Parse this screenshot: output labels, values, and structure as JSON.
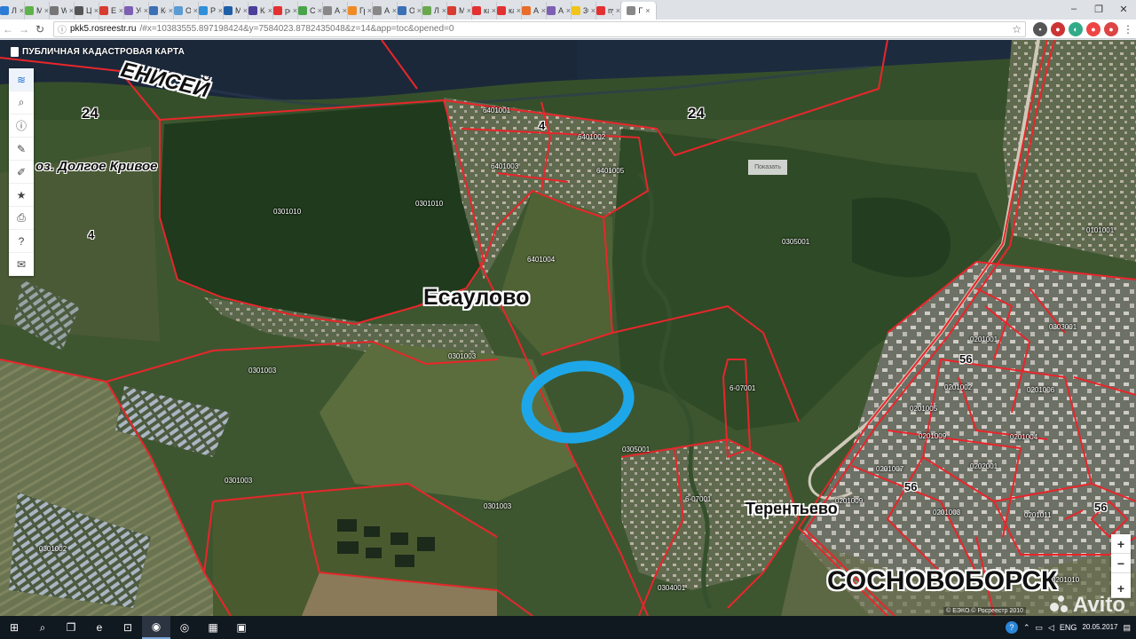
{
  "browser": {
    "tabs": [
      {
        "label": "Лич",
        "color": "#2d7bd6"
      },
      {
        "label": "Мо",
        "color": "#5fb24a"
      },
      {
        "label": "Wiu",
        "color": "#777777"
      },
      {
        "label": "Цен",
        "color": "#555555"
      },
      {
        "label": "Ekin",
        "color": "#d83b30"
      },
      {
        "label": "Услу",
        "color": "#7d5fb3"
      },
      {
        "label": "Конт",
        "color": "#3b6fb6"
      },
      {
        "label": "ООС",
        "color": "#5a9bd5"
      },
      {
        "label": "Реда",
        "color": "#2f8fd8"
      },
      {
        "label": "Мои",
        "color": "#1f5fa8"
      },
      {
        "label": "Каби",
        "color": "#4a3f9a"
      },
      {
        "label": "рекл",
        "color": "#e33131"
      },
      {
        "label": "Спец",
        "color": "#4aa34a"
      },
      {
        "label": "Арен",
        "color": "#888888"
      },
      {
        "label": "Груп",
        "color": "#f08a24"
      },
      {
        "label": "Арен",
        "color": "#888888"
      },
      {
        "label": "Объ",
        "color": "#3b6fb6"
      },
      {
        "label": "Лизн",
        "color": "#6aa84f"
      },
      {
        "label": "Мой",
        "color": "#d83b30"
      },
      {
        "label": "как",
        "color": "#e33131"
      },
      {
        "label": "кам",
        "color": "#e33131"
      },
      {
        "label": "Арен",
        "color": "#e86c2a"
      },
      {
        "label": "Арен",
        "color": "#7d5fb3"
      },
      {
        "label": "365",
        "color": "#f0c419"
      },
      {
        "label": "пуб",
        "color": "#e33131"
      },
      {
        "label": "Г",
        "color": "#888888",
        "active": true
      }
    ],
    "window_controls": [
      "–",
      "❐",
      "✕"
    ],
    "nav": {
      "back": "←",
      "forward": "→",
      "reload": "↻"
    },
    "url_host": "pkk5.rosreestr.ru",
    "url_rest": "/#x=10383555.897198424&y=7584023.8782435048&z=14&app=toc&opened=0",
    "star": "☆"
  },
  "map": {
    "title": "ПУБЛИЧНАЯ КАДАСТРОВАЯ КАРТА",
    "toolbar": [
      {
        "name": "layers",
        "glyph": "≋",
        "active": true
      },
      {
        "name": "search",
        "glyph": "⌕"
      },
      {
        "name": "info",
        "glyph": "ⓘ"
      },
      {
        "name": "measure",
        "glyph": "✎"
      },
      {
        "name": "draw",
        "glyph": "✐"
      },
      {
        "name": "bookmark",
        "glyph": "★"
      },
      {
        "name": "print",
        "glyph": "⎙"
      },
      {
        "name": "help",
        "glyph": "?"
      },
      {
        "name": "mail",
        "glyph": "✉"
      }
    ],
    "zoom_in": "+",
    "zoom_out": "−",
    "extra_zoom": "+",
    "show_button": "Показать",
    "labels": {
      "river": "ЕНИСЕЙ",
      "lake": "оз. Долгое Кривое",
      "esaulovo": "Есаулово",
      "terentevo": "Терентьево",
      "sosnovoborsk": "СОСНОВОБОРСК",
      "region24a": "24",
      "region24b": "24",
      "region4a": "4",
      "region4b": "4",
      "region56a": "56",
      "region56b": "56",
      "region56c": "56"
    },
    "codes": [
      "0301010",
      "0301010",
      "0301003",
      "0301003",
      "0301003",
      "0301003",
      "0301002",
      "6401004",
      "6401001",
      "6401002",
      "6401003",
      "6401005",
      "0305001",
      "0305001",
      "0304001",
      "0303001",
      "0101001",
      "0201002",
      "0201005",
      "0201009",
      "0201007",
      "0201003",
      "0201009",
      "0201004",
      "0201006",
      "0201001",
      "0201011",
      "0201010",
      "6-07001",
      "6-07001",
      "0202001"
    ],
    "copyright": "© ЕЭКО © Росреестр 2010",
    "watermark": "Avito",
    "colors": {
      "boundary": "#e8262b",
      "highlight": "#1ea7e8",
      "river": "#1d2b3f",
      "forest": "#1f3a1c",
      "field": "#6f7a4a"
    }
  },
  "taskbar": {
    "items": [
      {
        "name": "start",
        "glyph": "⊞"
      },
      {
        "name": "search",
        "glyph": "⌕"
      },
      {
        "name": "task-view",
        "glyph": "❐"
      },
      {
        "name": "edge",
        "glyph": "e"
      },
      {
        "name": "store",
        "glyph": "⊡"
      },
      {
        "name": "chrome",
        "glyph": "◉",
        "active": true
      },
      {
        "name": "media",
        "glyph": "◎"
      },
      {
        "name": "photos",
        "glyph": "▦"
      },
      {
        "name": "screen",
        "glyph": "▣"
      }
    ],
    "lang": "ENG",
    "time": "",
    "date": "20.05.2017"
  }
}
